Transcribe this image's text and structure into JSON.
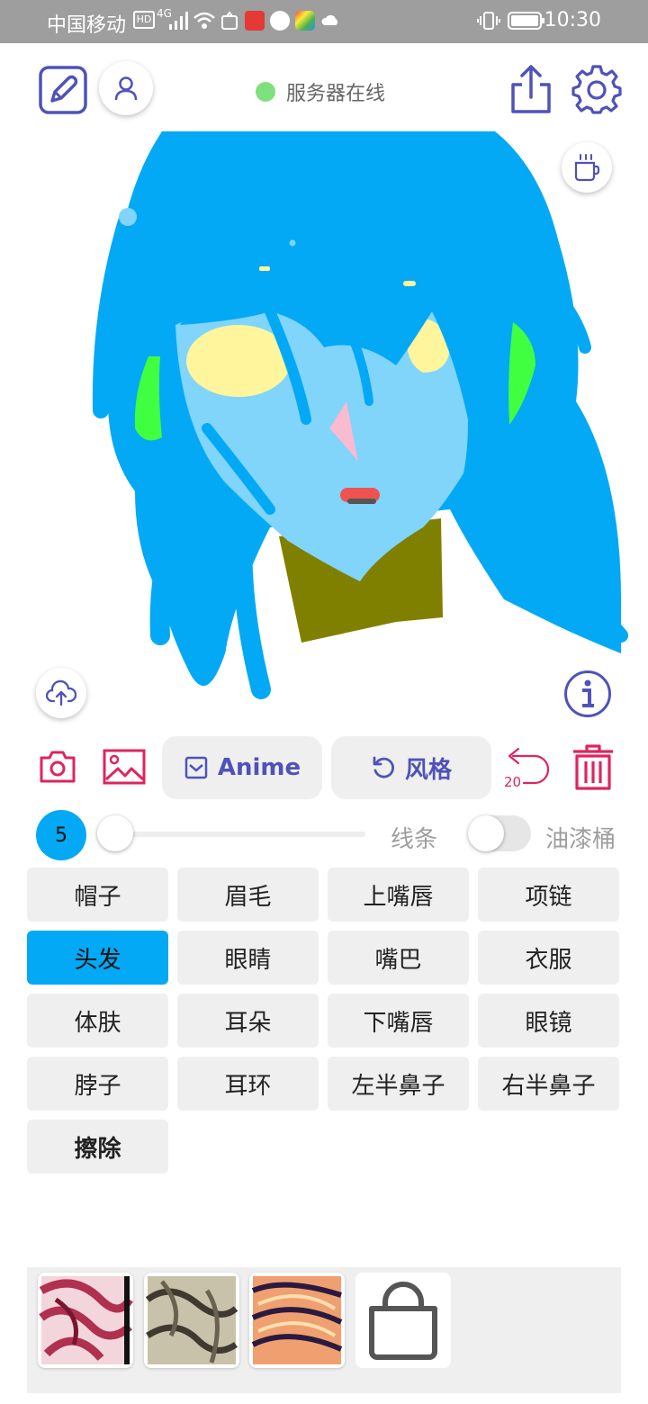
{
  "status_bar": {
    "carrier": "中国移动",
    "network": "4G",
    "time": "10:30"
  },
  "toolbar": {
    "server_status": "服务器在线",
    "server_status_color": "#7ee07e"
  },
  "actions": {
    "anime_label": "Anime",
    "style_label": "风格",
    "undo_count": "20"
  },
  "brush": {
    "size": "5",
    "slider_level": 0,
    "line_label": "线条",
    "bucket_label": "油漆桶",
    "bucket_enabled": false
  },
  "parts": [
    {
      "label": "帽子"
    },
    {
      "label": "眉毛"
    },
    {
      "label": "上嘴唇"
    },
    {
      "label": "项链"
    },
    {
      "label": "头发",
      "selected": true
    },
    {
      "label": "眼睛"
    },
    {
      "label": "嘴巴"
    },
    {
      "label": "衣服"
    },
    {
      "label": "体肤"
    },
    {
      "label": "耳朵"
    },
    {
      "label": "下嘴唇"
    },
    {
      "label": "眼镜"
    },
    {
      "label": "脖子"
    },
    {
      "label": "耳环"
    },
    {
      "label": "左半鼻子"
    },
    {
      "label": "右半鼻子"
    },
    {
      "label": "擦除"
    }
  ],
  "colors": {
    "accent": "#4f52b8",
    "danger": "#e0245e",
    "hair": "#03a9f4",
    "skin": "#81d4fa",
    "clothes": "#808000"
  },
  "style_thumbnails": [
    "style-pink",
    "style-gray",
    "style-orange"
  ],
  "shop_icon": "shopping-bag-icon"
}
